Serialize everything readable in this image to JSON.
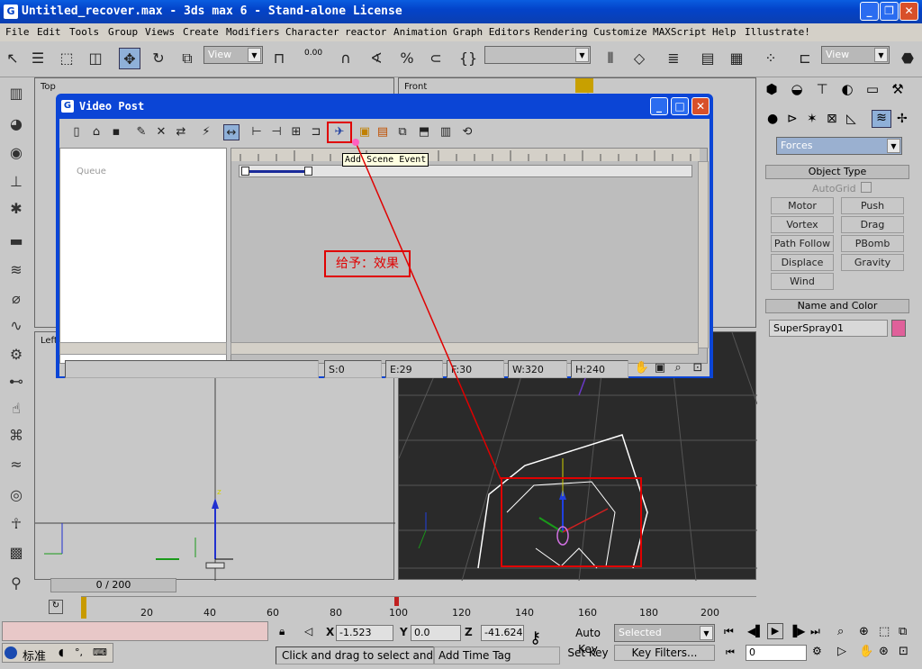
{
  "window": {
    "title": "Untitled_recover.max - 3ds max 6 - Stand-alone License"
  },
  "menu": [
    "File",
    "Edit",
    "Tools",
    "Group",
    "Views",
    "Create",
    "Modifiers",
    "Character",
    "reactor",
    "Animation",
    "Graph Editors",
    "Rendering",
    "Customize",
    "MAXScript",
    "Help",
    "Illustrate!"
  ],
  "toolbar": {
    "view_combo_1": "View",
    "view_combo_2": "View",
    "threshold": "0.00"
  },
  "viewports": {
    "top": "Top",
    "front": "Front",
    "left": "Left"
  },
  "video_post": {
    "title": "Video Post",
    "queue_label": "Queue",
    "tooltip": "Add Scene Event",
    "status": {
      "s": "S:0",
      "e": "E:29",
      "f": "F:30",
      "w": "W:320",
      "h": "H:240"
    }
  },
  "annotation": {
    "text": "给予：效果",
    "color": "#e00000"
  },
  "right_panel": {
    "category": "Forces",
    "object_type_header": "Object Type",
    "autogrid": "AutoGrid",
    "buttons": [
      "Motor",
      "Push",
      "Vortex",
      "Drag",
      "Path Follow",
      "PBomb",
      "Displace",
      "Gravity",
      "Wind"
    ],
    "name_color_header": "Name and Color",
    "object_name": "SuperSpray01",
    "object_color": "#e0609a"
  },
  "timeline": {
    "frame_counter": "0 / 200",
    "ticks": [
      "20",
      "40",
      "60",
      "80",
      "100",
      "120",
      "140",
      "160",
      "180",
      "200"
    ]
  },
  "bottom": {
    "x_label": "X",
    "x_value": "-1.523",
    "y_label": "Y",
    "y_value": "0.0",
    "z_label": "Z",
    "z_value": "-41.624",
    "auto_key": "Auto Key",
    "set_key": "Set Key",
    "selected": "Selected",
    "key_filters": "Key Filters...",
    "frame_field": "0",
    "prompt": "Click and drag to select and move",
    "add_time_tag": "Add Time Tag",
    "ime_label": "标准"
  }
}
